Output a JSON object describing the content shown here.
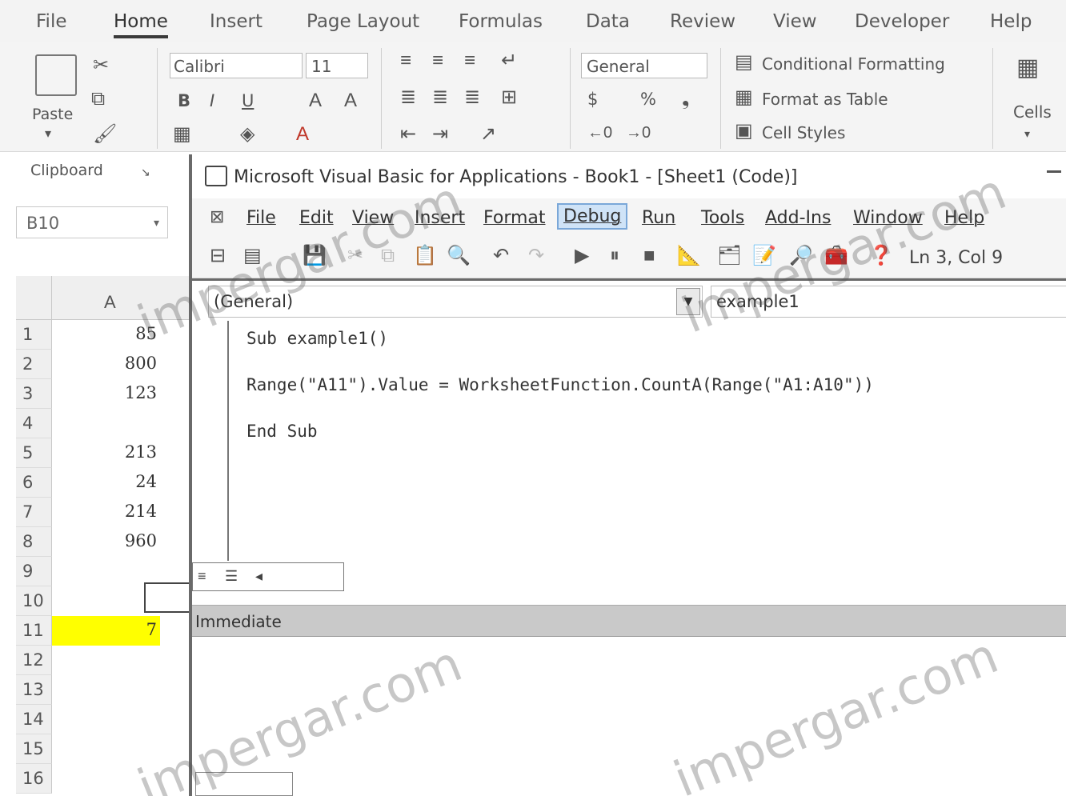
{
  "excel": {
    "tabs": [
      "File",
      "Home",
      "Insert",
      "Page Layout",
      "Formulas",
      "Data",
      "Review",
      "View",
      "Developer",
      "Help"
    ],
    "active_tab": "Home",
    "clipboard": {
      "paste_label": "Paste",
      "group_label": "Clipboard"
    },
    "font": {
      "name": "Calibri",
      "size": "11",
      "bold": "B",
      "italic": "I",
      "underline": "U"
    },
    "number": {
      "format": "General",
      "currency": "$",
      "percent": "%"
    },
    "styles": {
      "conditional": "Conditional Formatting",
      "format_table": "Format as Table",
      "cell_styles": "Cell Styles"
    },
    "cells_label": "Cells",
    "name_box": "B10",
    "column_header": "A",
    "rows": [
      {
        "n": "1",
        "v": "85"
      },
      {
        "n": "2",
        "v": "800"
      },
      {
        "n": "3",
        "v": "123"
      },
      {
        "n": "4",
        "v": ""
      },
      {
        "n": "5",
        "v": "213"
      },
      {
        "n": "6",
        "v": "24"
      },
      {
        "n": "7",
        "v": "214"
      },
      {
        "n": "8",
        "v": "960"
      },
      {
        "n": "9",
        "v": ""
      },
      {
        "n": "10",
        "v": ""
      },
      {
        "n": "11",
        "v": "7"
      },
      {
        "n": "12",
        "v": ""
      },
      {
        "n": "13",
        "v": ""
      },
      {
        "n": "14",
        "v": ""
      },
      {
        "n": "15",
        "v": ""
      },
      {
        "n": "16",
        "v": ""
      }
    ],
    "highlight_color": "#ffff00"
  },
  "vbe": {
    "title": "Microsoft Visual Basic for Applications - Book1 - [Sheet1 (Code)]",
    "menu": [
      "File",
      "Edit",
      "View",
      "Insert",
      "Format",
      "Debug",
      "Run",
      "Tools",
      "Add-Ins",
      "Window",
      "Help"
    ],
    "active_menu": "Debug",
    "cursor_position": "Ln 3, Col 9",
    "object_combo": "(General)",
    "procedure_combo": "example1",
    "code": [
      "Sub example1()",
      "Range(\"A11\").Value = WorksheetFunction.CountA(Range(\"A1:A10\"))",
      "End Sub"
    ],
    "immediate_title": "Immediate"
  },
  "watermark": "impergar.com"
}
